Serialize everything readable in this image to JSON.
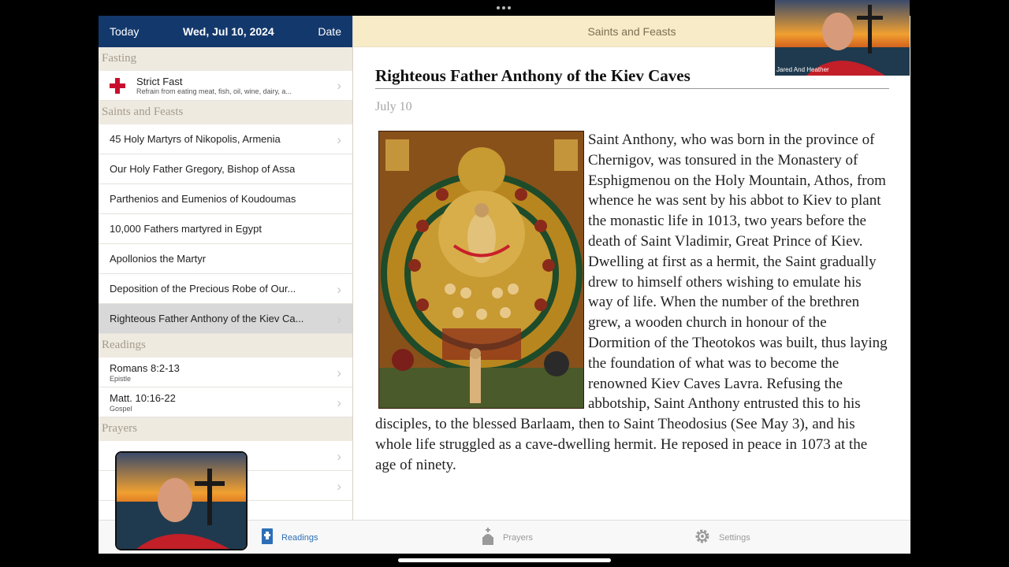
{
  "sidebar": {
    "header": {
      "today": "Today",
      "date": "Wed, Jul 10, 2024",
      "date_button": "Date"
    },
    "sections": {
      "fasting": "Fasting",
      "saints": "Saints and Feasts",
      "readings": "Readings",
      "prayers": "Prayers"
    },
    "fast": {
      "title": "Strict Fast",
      "description": "Refrain from eating meat, fish, oil, wine, dairy, a..."
    },
    "saints": [
      "45 Holy Martyrs of Nikopolis, Armenia",
      "Our Holy Father Gregory, Bishop of Assa",
      "Parthenios and Eumenios of Koudoumas",
      "10,000 Fathers martyred in Egypt",
      "Apollonios the Martyr",
      "Deposition of the Precious Robe of Our...",
      "Righteous Father Anthony of the Kiev Ca..."
    ],
    "readings": [
      {
        "title": "Romans 8:2-13",
        "type": "Epistle"
      },
      {
        "title": "Matt. 10:16-22",
        "type": "Gospel"
      }
    ]
  },
  "main": {
    "header": "Saints and Feasts",
    "title": "Righteous Father Anthony of the Kiev Caves",
    "date": "July 10",
    "body": "Saint Anthony, who was born in the province of Chernigov, was tonsured in the Monastery of Esphigmenou on the Holy Mountain, Athos, from whence he was sent by his abbot to Kiev to plant the monastic life in 1013, two years before the death of Saint Vladimir, Great Prince of Kiev. Dwelling at first as a hermit, the Saint gradually drew to himself others wishing to emulate his way of life. When the number of the brethren grew, a wooden church in honour of the Dormition of the Theotokos was built, thus laying the foundation of what was to become the renowned Kiev Caves Lavra. Refusing the abbotship, Saint Anthony entrusted this to his disciples, to the blessed Barlaam, then to Saint Theodosius (See May 3), and his whole life struggled as a cave-dwelling hermit. He reposed in peace in 1073 at the age of ninety."
  },
  "tabs": {
    "readings": "Readings",
    "prayers": "Prayers",
    "settings": "Settings"
  },
  "overlay": {
    "cam_name": "Jared And Heather"
  },
  "colors": {
    "header_blue": "#13386c",
    "accent_cream": "#f7ecc7",
    "fast_red": "#c8102e",
    "tab_active": "#2c6fb6"
  }
}
